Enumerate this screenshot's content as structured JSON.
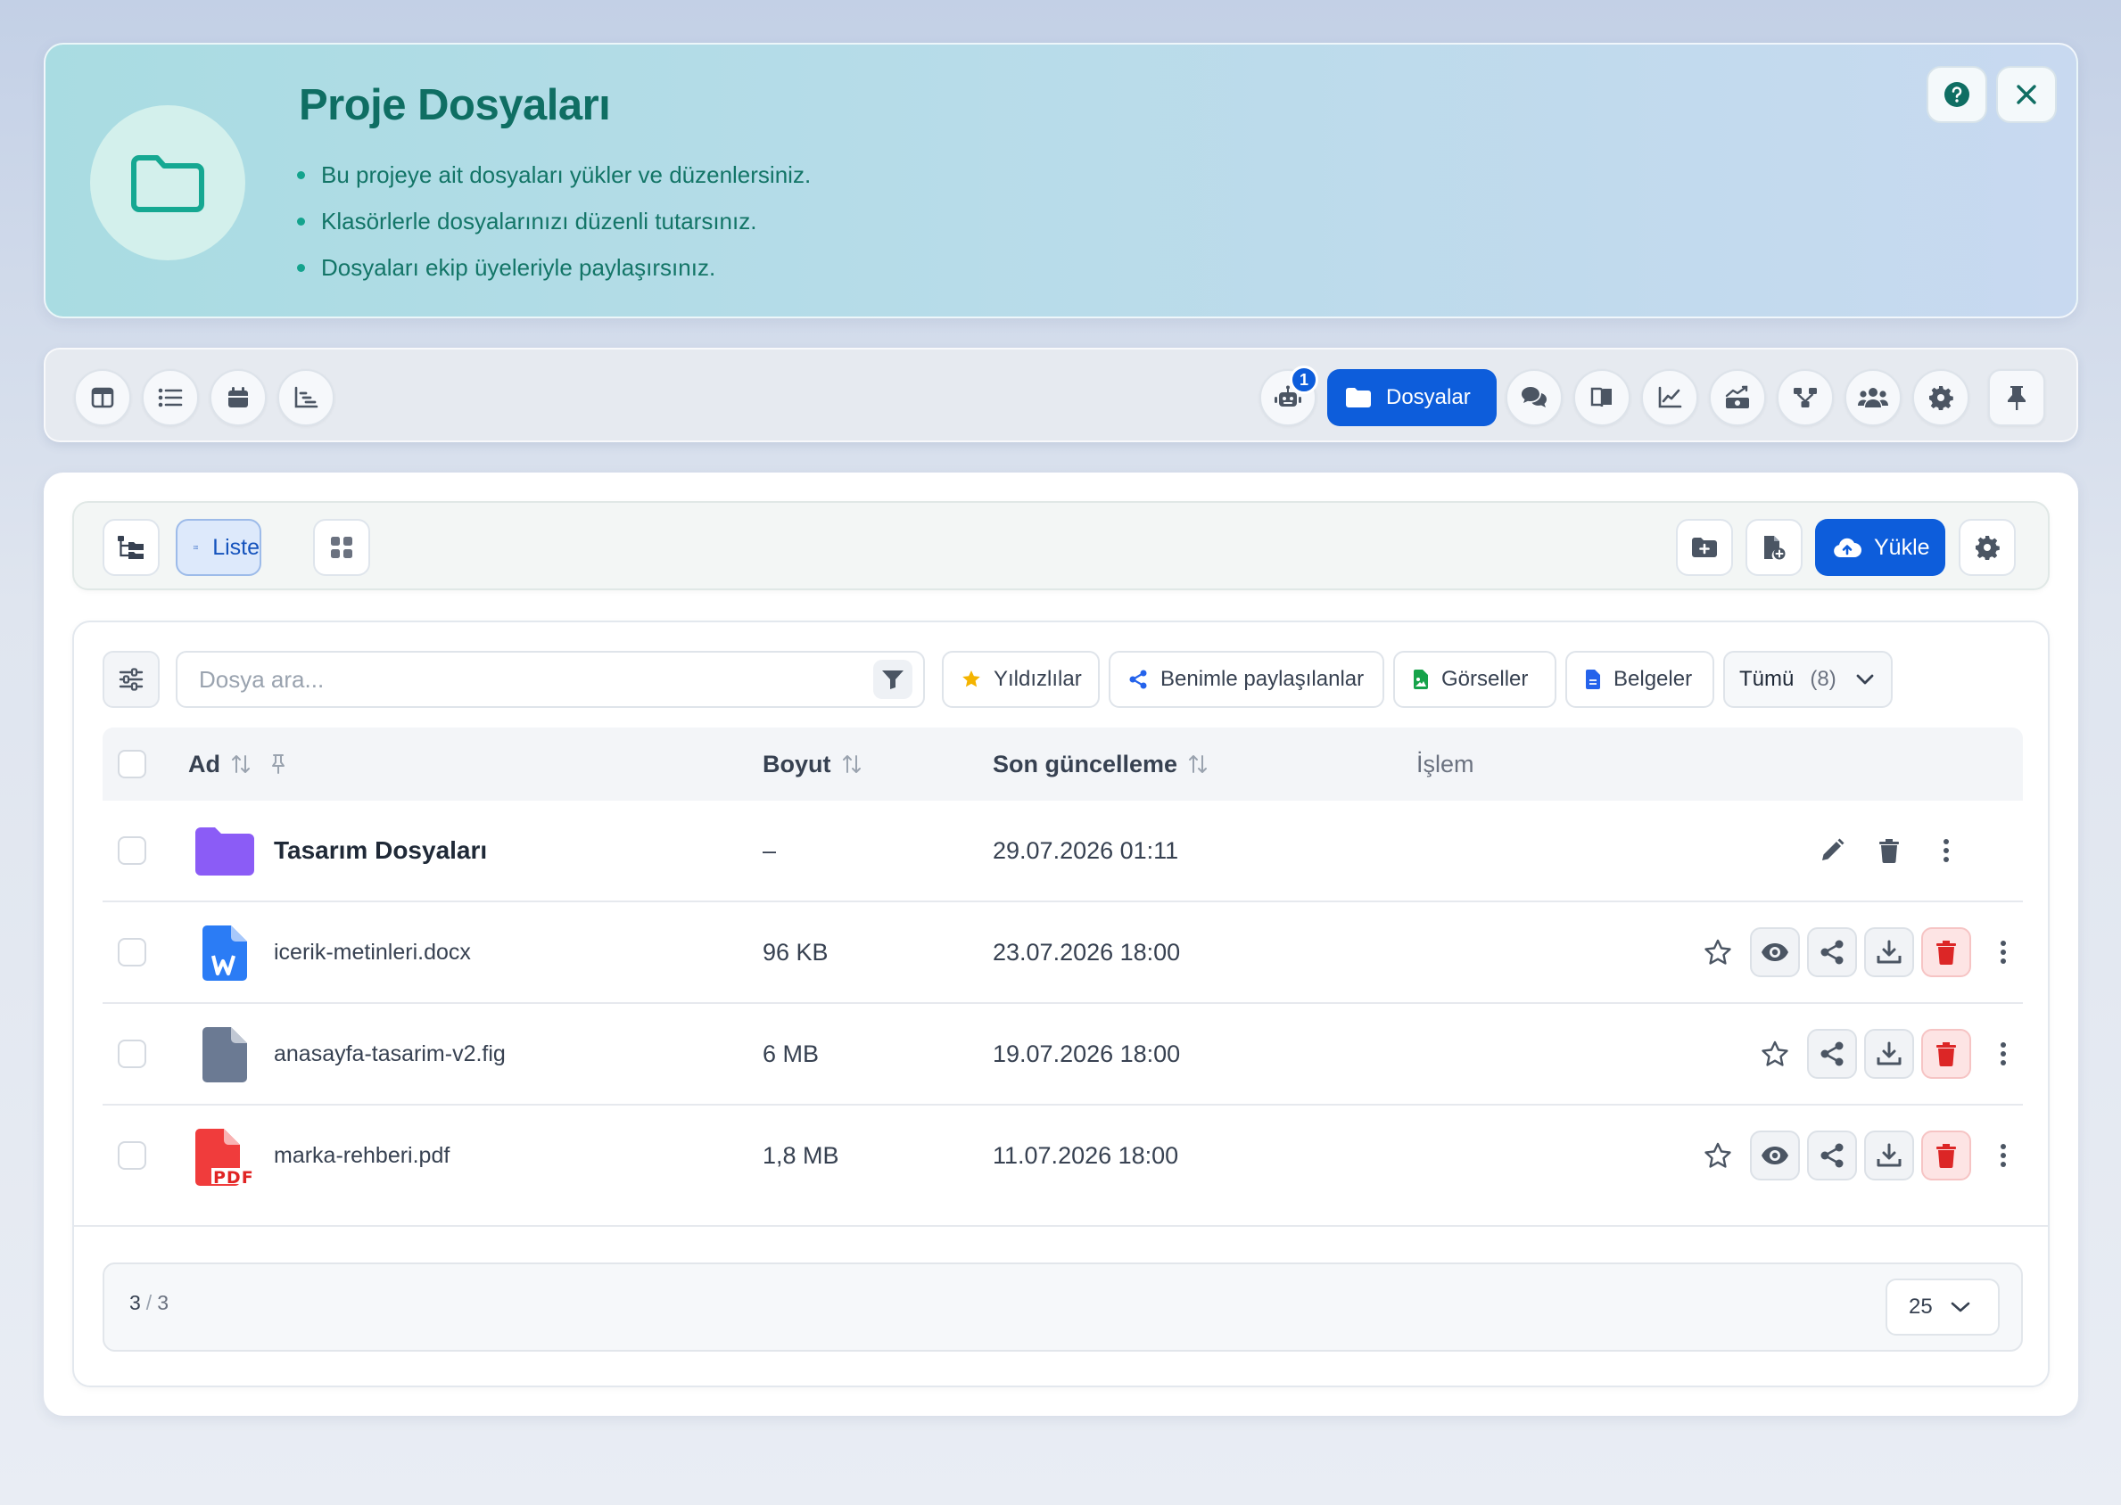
{
  "hero": {
    "title": "Proje Dosyaları",
    "bullets": [
      "Bu projeye ait dosyaları yükler ve düzenlersiniz.",
      "Klasörlerle dosyalarınızı düzenli tutarsınız.",
      "Dosyaları ekip üyeleriyle paylaşırsınız."
    ],
    "icon": "folder-icon",
    "accent": "#14a38d"
  },
  "nav": {
    "active_label": "Dosyalar",
    "robot_badge": "1",
    "accent": "#0d5ddb"
  },
  "toolbar": {
    "list_label": "Liste",
    "upload_label": "Yükle"
  },
  "filters": {
    "search_placeholder": "Dosya ara...",
    "starred": "Yıldızlılar",
    "shared": "Benimle paylaşılanlar",
    "images": "Görseller",
    "documents": "Belgeler",
    "all": "Tümü",
    "all_count": "(8)"
  },
  "table": {
    "headers": {
      "name": "Ad",
      "size": "Boyut",
      "updated": "Son güncelleme",
      "action": "İşlem"
    },
    "rows": [
      {
        "name": "Tasarım Dosyaları",
        "size": "–",
        "updated": "29.07.2026 01:11",
        "type": "folder"
      },
      {
        "name": "icerik-metinleri.docx",
        "size": "96 KB",
        "updated": "23.07.2026 18:00",
        "type": "docx"
      },
      {
        "name": "anasayfa-tasarim-v2.fig",
        "size": "6 MB",
        "updated": "19.07.2026 18:00",
        "type": "file"
      },
      {
        "name": "marka-rehberi.pdf",
        "size": "1,8 MB",
        "updated": "11.07.2026 18:00",
        "type": "pdf"
      }
    ]
  },
  "pager": {
    "shown": "3",
    "separator": "/",
    "total": "3",
    "page_size": "25"
  }
}
